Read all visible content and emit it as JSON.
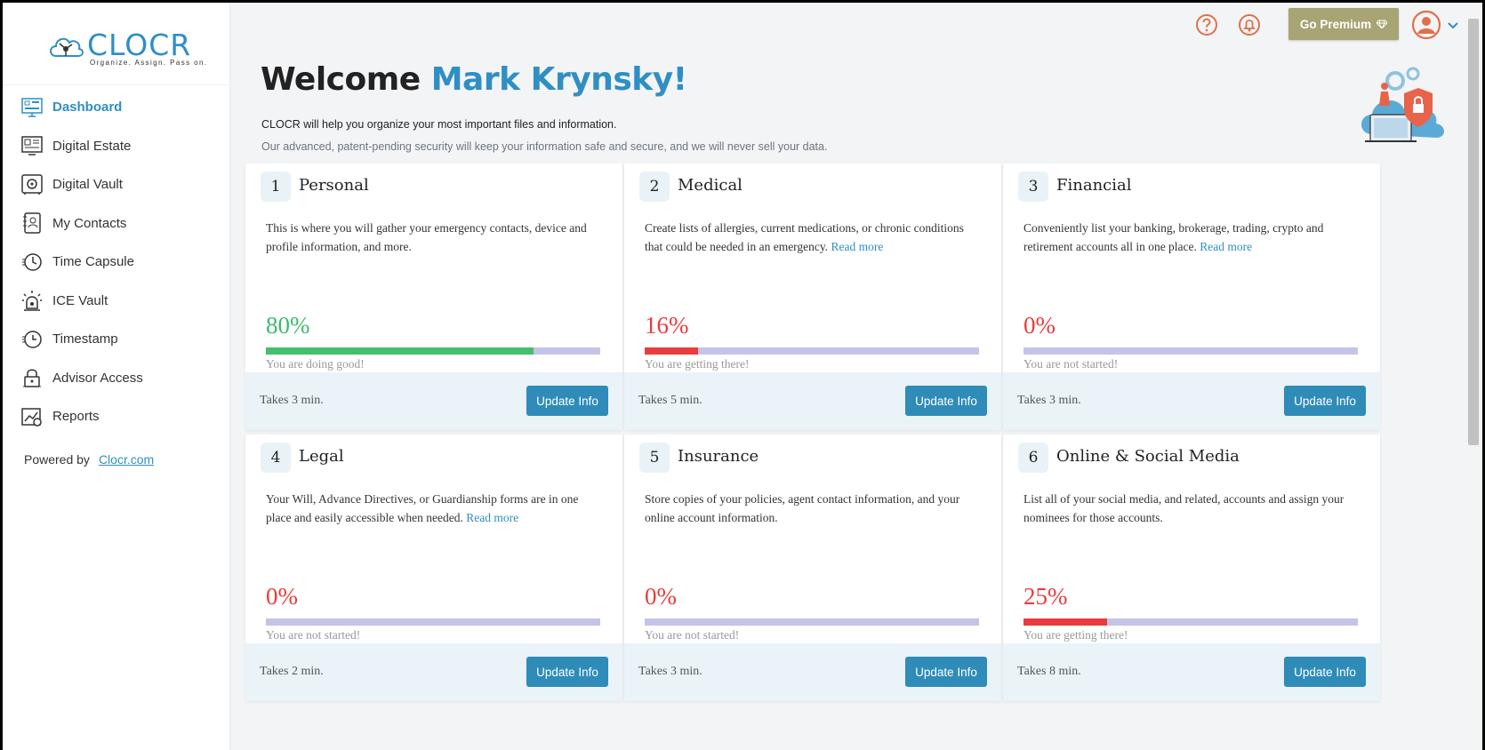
{
  "brand": {
    "name": "CLOCR",
    "tagline": "Organize. Assign. Pass on."
  },
  "sidebar": {
    "items": [
      {
        "label": "Dashboard",
        "icon": "dashboard-icon",
        "active": true
      },
      {
        "label": "Digital Estate",
        "icon": "digital-estate-icon"
      },
      {
        "label": "Digital Vault",
        "icon": "vault-icon"
      },
      {
        "label": "My Contacts",
        "icon": "contacts-icon"
      },
      {
        "label": "Time Capsule",
        "icon": "time-capsule-icon"
      },
      {
        "label": "ICE Vault",
        "icon": "alarm-icon"
      },
      {
        "label": "Timestamp",
        "icon": "timestamp-icon"
      },
      {
        "label": "Advisor Access",
        "icon": "advisor-lock-icon"
      },
      {
        "label": "Reports",
        "icon": "reports-icon"
      }
    ],
    "powered_by": "Powered by",
    "powered_link": "Clocr.com"
  },
  "topbar": {
    "premium_label": "Go Premium"
  },
  "welcome": {
    "greeting": "Welcome",
    "name": "Mark Krynsky!",
    "line1": "CLOCR will help you organize your most important files and information.",
    "line2": "Our advanced, patent-pending security will keep your information safe and secure, and we will never sell your data."
  },
  "colors": {
    "accent": "#2f8fc4",
    "premium": "#a8a474",
    "good": "#45bf6d",
    "warn": "#ea3c3c",
    "track": "#c4c3e8"
  },
  "cards": [
    {
      "num": "1",
      "title": "Personal",
      "desc": "This is where you will gather your emergency contacts, device and profile information, and more.",
      "read_more": "",
      "percent_label": "80%",
      "percent": 80,
      "status": "You are doing good!",
      "takes": "Takes 3 min.",
      "button": "Update Info",
      "tone": "green"
    },
    {
      "num": "2",
      "title": "Medical",
      "desc": "Create lists of allergies, current medications, or chronic conditions that could be needed in an emergency.",
      "read_more": "Read more",
      "percent_label": "16%",
      "percent": 16,
      "status": "You are getting there!",
      "takes": "Takes 5 min.",
      "button": "Update Info",
      "tone": "red"
    },
    {
      "num": "3",
      "title": "Financial",
      "desc": "Conveniently list your banking, brokerage, trading, crypto and retirement accounts all in one place.",
      "read_more": "Read more",
      "percent_label": "0%",
      "percent": 0,
      "status": "You are not started!",
      "takes": "Takes 3 min.",
      "button": "Update Info",
      "tone": "red"
    },
    {
      "num": "4",
      "title": "Legal",
      "desc": "Your Will, Advance Directives, or Guardianship forms are in one place and easily accessible when needed.",
      "read_more": "Read more",
      "percent_label": "0%",
      "percent": 0,
      "status": "You are not started!",
      "takes": "Takes 2 min.",
      "button": "Update Info",
      "tone": "red"
    },
    {
      "num": "5",
      "title": "Insurance",
      "desc": "Store copies of your policies, agent contact information, and your online account information.",
      "read_more": "",
      "percent_label": "0%",
      "percent": 0,
      "status": "You are not started!",
      "takes": "Takes 3 min.",
      "button": "Update Info",
      "tone": "red"
    },
    {
      "num": "6",
      "title": "Online & Social Media",
      "desc": "List all of your social media, and related, accounts and assign your nominees for those accounts.",
      "read_more": "",
      "percent_label": "25%",
      "percent": 25,
      "status": "You are getting there!",
      "takes": "Takes 8 min.",
      "button": "Update Info",
      "tone": "red"
    }
  ]
}
